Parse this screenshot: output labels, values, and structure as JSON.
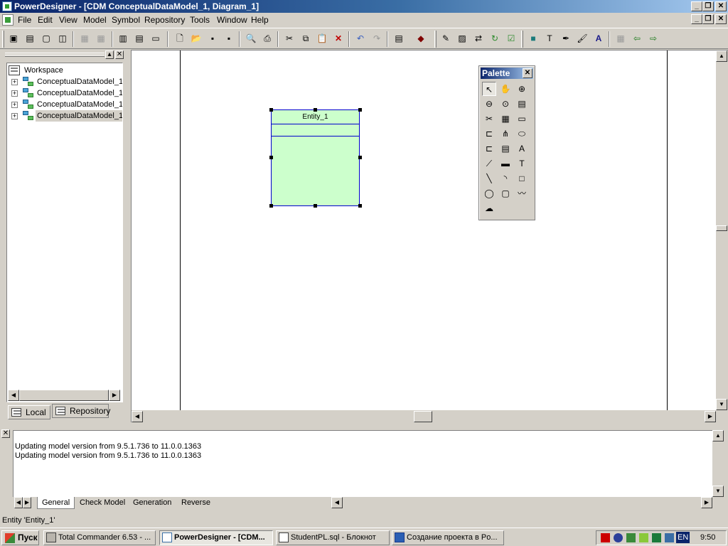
{
  "window": {
    "title": "PowerDesigner - [CDM ConceptualDataModel_1, Diagram_1]",
    "controls": {
      "minimize": "_",
      "restore": "❐",
      "close": "✕"
    }
  },
  "menu": [
    "File",
    "Edit",
    "View",
    "Model",
    "Symbol",
    "Repository",
    "Tools",
    "Window",
    "Help"
  ],
  "toolbar": {
    "icons": [
      "browser-icon",
      "output-icon",
      "result-icon",
      "window-icon",
      "view1-icon",
      "view2-icon",
      "grid1-icon",
      "grid2-icon",
      "grid3-icon",
      "new-icon",
      "open-icon",
      "save-icon",
      "save-all-icon",
      "print-preview-icon",
      "print-icon",
      "cut-icon",
      "copy-icon",
      "paste-icon",
      "delete-icon",
      "undo-icon",
      "redo-icon",
      "properties-icon",
      "book-icon",
      "edit-icon",
      "clipboard-icon",
      "replace-icon",
      "refresh-icon",
      "check-icon",
      "fill-icon",
      "text-format-icon",
      "pen-icon",
      "brush-icon",
      "font-icon",
      "folder-icon",
      "back-icon",
      "forward-icon"
    ]
  },
  "browser": {
    "root": "Workspace",
    "items": [
      "ConceptualDataModel_1",
      "ConceptualDataModel_1",
      "ConceptualDataModel_1",
      "ConceptualDataModel_1"
    ],
    "tabs": [
      "Local",
      "Repository"
    ]
  },
  "diagram": {
    "entity_name": "Entity_1"
  },
  "palette": {
    "title": "Palette",
    "tools": [
      "pointer",
      "grabber",
      "zoom-in",
      "zoom-out",
      "open-package",
      "properties",
      "cut",
      "entity",
      "inheritance",
      "relationship",
      "association",
      "link",
      "package",
      "file",
      "note",
      "link-2",
      "area",
      "text",
      "line",
      "arc",
      "rectangle",
      "ellipse",
      "rounded-rectangle",
      "polyline",
      "polygon"
    ],
    "glyphs": [
      "↖",
      "✋",
      "⊕",
      "⊖",
      "⊙",
      "▤",
      "✂",
      "▦",
      "▭",
      "⊏",
      "⋔",
      "⬭",
      "⊏",
      "▤",
      "A",
      "⟋",
      "▬",
      "T",
      "╲",
      "◝",
      "□",
      "◯",
      "▢",
      "〰",
      "☁"
    ]
  },
  "output": {
    "lines": [
      "Updating model version from 9.5.1.736 to 11.0.0.1363",
      "Updating model version from 9.5.1.736 to 11.0.0.1363"
    ],
    "tabs": [
      "General",
      "Check Model",
      "Generation",
      "Reverse"
    ]
  },
  "status": "Entity 'Entity_1'",
  "taskbar": {
    "start": "Пуск",
    "tasks": [
      "Total Commander 6.53 - ...",
      "PowerDesigner - [CDM...",
      "StudentPL.sql - Блокнот",
      "Создание проекта в Po..."
    ],
    "lang": "EN",
    "clock": "9:50"
  }
}
